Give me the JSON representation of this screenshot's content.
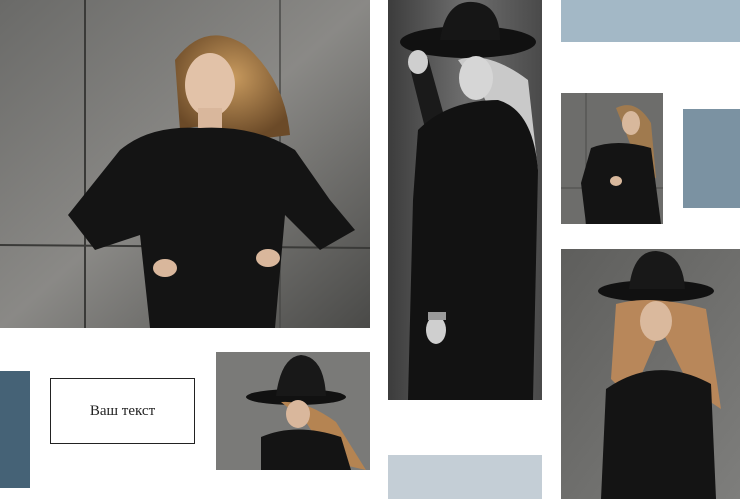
{
  "text_box": {
    "label": "Ваш текст"
  },
  "colors": {
    "block_top_right": "#a3b8c6",
    "block_right_middle": "#7b92a2",
    "block_left_bottom": "#456276",
    "block_bottom_center": "#c4ced6",
    "concrete_light": "#8c8c8a",
    "concrete_dark": "#2e2e2e",
    "outfit": "#141414"
  },
  "photos": [
    {
      "name": "woman-hands-on-hips-photo"
    },
    {
      "name": "woman-holding-hat-photo"
    },
    {
      "name": "woman-against-wall-small-photo"
    },
    {
      "name": "woman-in-hat-looking-down-photo"
    },
    {
      "name": "woman-in-hat-tall-photo"
    }
  ]
}
